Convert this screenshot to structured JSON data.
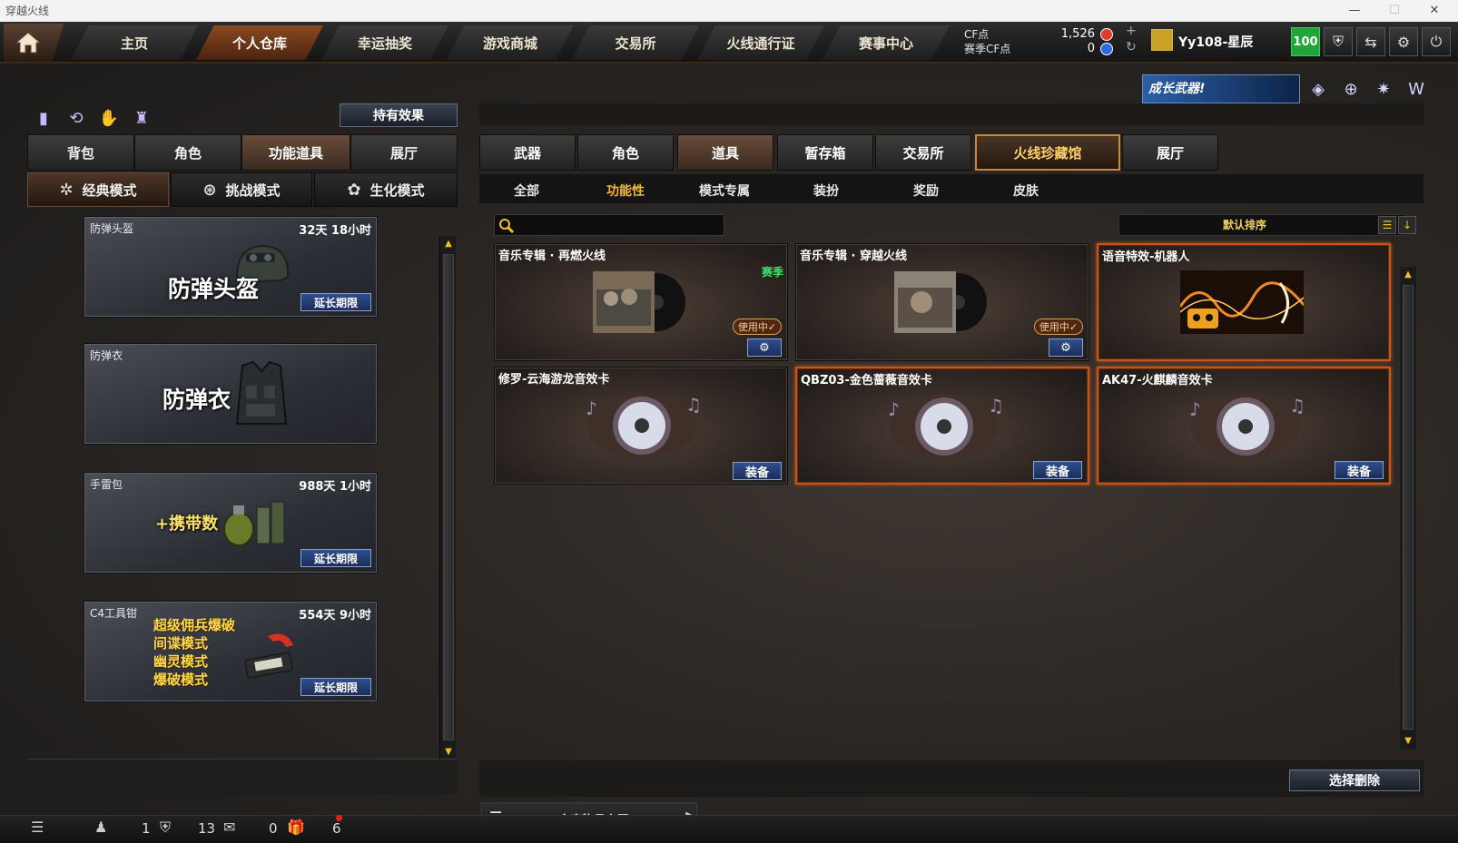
{
  "window": {
    "title": "穿越火线"
  },
  "nav": {
    "tabs": [
      "主页",
      "个人仓库",
      "幸运抽奖",
      "游戏商城",
      "交易所",
      "火线通行证",
      "赛事中心"
    ],
    "active": "个人仓库"
  },
  "currency": {
    "cf_label": "CF点",
    "cf_value": "1,526",
    "season_label": "赛季CF点",
    "season_value": "0"
  },
  "user": {
    "name": "Yy108-星辰",
    "level": "100"
  },
  "banner": {
    "text": "成长武器!"
  },
  "left": {
    "hold_button": "持有效果",
    "tabs": [
      "背包",
      "角色",
      "功能道具",
      "展厅"
    ],
    "active_tab": "功能道具",
    "modes": [
      "经典模式",
      "挑战模式",
      "生化模式"
    ],
    "active_mode": "经典模式",
    "items": [
      {
        "name": "防弹头盔",
        "time": "32天 18小时",
        "big": "防弹头盔",
        "action": "延长期限"
      },
      {
        "name": "防弹衣",
        "time": "",
        "big": "防弹衣",
        "action": ""
      },
      {
        "name": "手雷包",
        "time": "988天 1小时",
        "big": "+携带数",
        "action": "延长期限"
      },
      {
        "name": "C4工具钳",
        "time": "554天 9小时",
        "lines": [
          "超级佣兵爆破",
          "间谍模式",
          "幽灵模式",
          "爆破模式"
        ],
        "action": "延长期限"
      }
    ]
  },
  "right": {
    "tabs": [
      "武器",
      "角色",
      "道具",
      "暂存箱",
      "交易所",
      "火线珍藏馆",
      "展厅"
    ],
    "active_tab": "道具",
    "gold_tab": "火线珍藏馆",
    "subtabs": [
      "全部",
      "功能性",
      "模式专属",
      "装扮",
      "奖励",
      "皮肤"
    ],
    "active_subtab": "功能性",
    "search_placeholder": "",
    "sort_label": "默认排序",
    "cards": [
      {
        "name": "音乐专辑 · 再燃火线",
        "badge": "赛季",
        "status": "使用中✓",
        "type": "album"
      },
      {
        "name": "音乐专辑 · 穿越火线",
        "badge": "",
        "status": "使用中✓",
        "type": "album"
      },
      {
        "name": "语音特效-机器人",
        "badge": "",
        "status": "",
        "type": "voice"
      },
      {
        "name": "修罗-云海游龙音效卡",
        "badge": "",
        "status": "",
        "type": "disc",
        "action": "装备"
      },
      {
        "name": "QBZ03-金色蔷薇音效卡",
        "badge": "",
        "status": "",
        "type": "disc",
        "action": "装备"
      },
      {
        "name": "AK47-火麒麟音效卡",
        "badge": "",
        "status": "",
        "type": "disc",
        "action": "装备"
      }
    ],
    "delete_button": "选择删除",
    "storage_limit": "仓库物品上限"
  },
  "statusbar": {
    "counts": [
      "1",
      "13",
      "0",
      "6"
    ]
  },
  "colors": {
    "accent": "#c2561c",
    "gold": "#f4b93a",
    "season_green": "#3ee06a",
    "button_blue": "#2f4f8f"
  }
}
